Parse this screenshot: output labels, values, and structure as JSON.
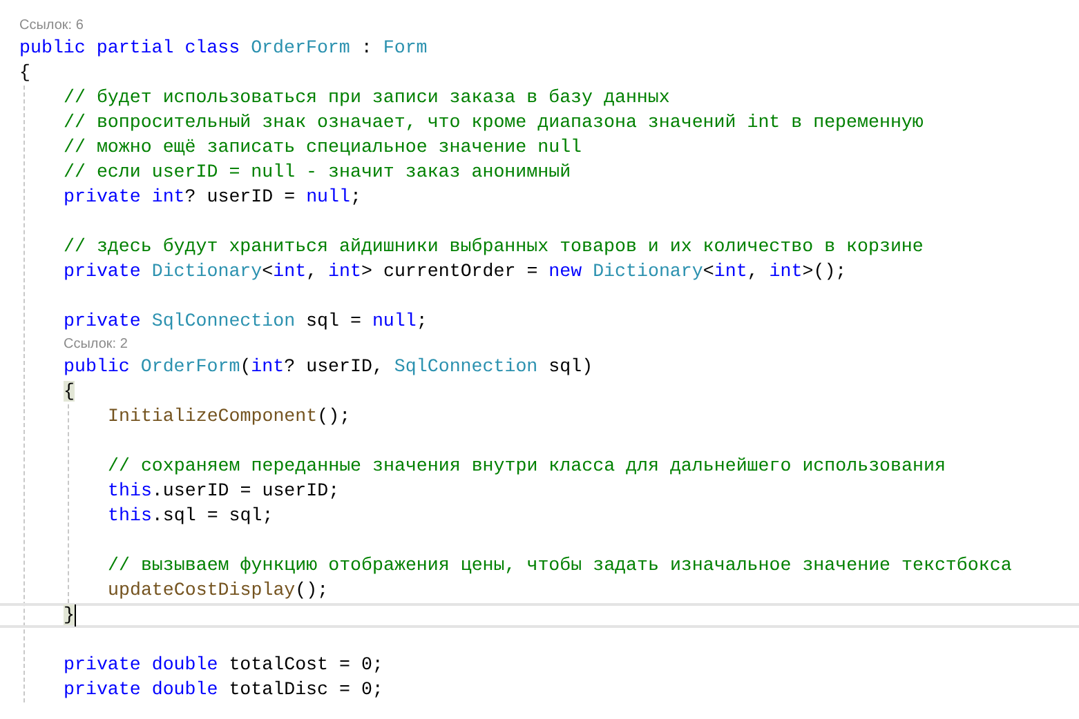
{
  "code": [
    {
      "kind": "lens",
      "text": "Ссылок: 6"
    },
    {
      "kind": "line",
      "tokens": [
        {
          "kind": "keyword",
          "text": "public partial class "
        },
        {
          "kind": "type",
          "text": "OrderForm"
        },
        {
          "kind": "plain",
          "text": " : "
        },
        {
          "kind": "type",
          "text": "Form"
        }
      ]
    },
    {
      "kind": "line",
      "tokens": [
        {
          "kind": "plain",
          "text": "{"
        }
      ]
    },
    {
      "kind": "block",
      "children": [
        {
          "kind": "line",
          "tokens": [
            {
              "kind": "comment",
              "text": "// будет использоваться при записи заказа в базу данных"
            }
          ]
        },
        {
          "kind": "line",
          "tokens": [
            {
              "kind": "comment",
              "text": "// вопросительный знак означает, что кроме диапазона значений int в переменную"
            }
          ]
        },
        {
          "kind": "line",
          "tokens": [
            {
              "kind": "comment",
              "text": "// можно ещё записать специальное значение null"
            }
          ]
        },
        {
          "kind": "line",
          "tokens": [
            {
              "kind": "comment",
              "text": "// если userID = null - значит заказ анонимный"
            }
          ]
        },
        {
          "kind": "line",
          "tokens": [
            {
              "kind": "keyword",
              "text": "private int"
            },
            {
              "kind": "plain",
              "text": "? userID = "
            },
            {
              "kind": "keyword",
              "text": "null"
            },
            {
              "kind": "plain",
              "text": ";"
            }
          ]
        },
        {
          "kind": "blank"
        },
        {
          "kind": "line",
          "tokens": [
            {
              "kind": "comment",
              "text": "// здесь будут храниться айдишники выбранных товаров и их количество в корзине"
            }
          ]
        },
        {
          "kind": "line",
          "tokens": [
            {
              "kind": "keyword",
              "text": "private "
            },
            {
              "kind": "type",
              "text": "Dictionary"
            },
            {
              "kind": "plain",
              "text": "<"
            },
            {
              "kind": "keyword",
              "text": "int"
            },
            {
              "kind": "plain",
              "text": ", "
            },
            {
              "kind": "keyword",
              "text": "int"
            },
            {
              "kind": "plain",
              "text": "> currentOrder = "
            },
            {
              "kind": "keyword",
              "text": "new "
            },
            {
              "kind": "type",
              "text": "Dictionary"
            },
            {
              "kind": "plain",
              "text": "<"
            },
            {
              "kind": "keyword",
              "text": "int"
            },
            {
              "kind": "plain",
              "text": ", "
            },
            {
              "kind": "keyword",
              "text": "int"
            },
            {
              "kind": "plain",
              "text": ">();"
            }
          ]
        },
        {
          "kind": "blank"
        },
        {
          "kind": "line",
          "tokens": [
            {
              "kind": "keyword",
              "text": "private "
            },
            {
              "kind": "type",
              "text": "SqlConnection"
            },
            {
              "kind": "plain",
              "text": " sql = "
            },
            {
              "kind": "keyword",
              "text": "null"
            },
            {
              "kind": "plain",
              "text": ";"
            }
          ]
        },
        {
          "kind": "lens",
          "text": "Ссылок: 2"
        },
        {
          "kind": "line",
          "tokens": [
            {
              "kind": "keyword",
              "text": "public "
            },
            {
              "kind": "type",
              "text": "OrderForm"
            },
            {
              "kind": "plain",
              "text": "("
            },
            {
              "kind": "keyword",
              "text": "int"
            },
            {
              "kind": "plain",
              "text": "? userID, "
            },
            {
              "kind": "type",
              "text": "SqlConnection"
            },
            {
              "kind": "plain",
              "text": " sql)"
            }
          ]
        },
        {
          "kind": "line",
          "tokens": [
            {
              "kind": "brace_match",
              "text": "{"
            }
          ]
        },
        {
          "kind": "block",
          "children": [
            {
              "kind": "line",
              "tokens": [
                {
                  "kind": "method",
                  "text": "InitializeComponent"
                },
                {
                  "kind": "plain",
                  "text": "();"
                }
              ]
            },
            {
              "kind": "blank"
            },
            {
              "kind": "line",
              "tokens": [
                {
                  "kind": "comment",
                  "text": "// сохраняем переданные значения внутри класса для дальнейшего использования"
                }
              ]
            },
            {
              "kind": "line",
              "tokens": [
                {
                  "kind": "keyword",
                  "text": "this"
                },
                {
                  "kind": "plain",
                  "text": ".userID = userID;"
                }
              ]
            },
            {
              "kind": "line",
              "tokens": [
                {
                  "kind": "keyword",
                  "text": "this"
                },
                {
                  "kind": "plain",
                  "text": ".sql = sql;"
                }
              ]
            },
            {
              "kind": "blank"
            },
            {
              "kind": "line",
              "tokens": [
                {
                  "kind": "comment",
                  "text": "// вызываем функцию отображения цены, чтобы задать изначальное значение текстбокса"
                }
              ]
            },
            {
              "kind": "line",
              "tokens": [
                {
                  "kind": "method",
                  "text": "updateCostDisplay"
                },
                {
                  "kind": "plain",
                  "text": "();"
                }
              ]
            }
          ]
        },
        {
          "kind": "current_line",
          "tokens": [
            {
              "kind": "brace_match",
              "text": "}"
            }
          ]
        },
        {
          "kind": "blank"
        },
        {
          "kind": "line",
          "tokens": [
            {
              "kind": "keyword",
              "text": "private double "
            },
            {
              "kind": "plain",
              "text": "totalCost = 0;"
            }
          ]
        },
        {
          "kind": "line",
          "tokens": [
            {
              "kind": "keyword",
              "text": "private double "
            },
            {
              "kind": "plain",
              "text": "totalDisc = 0;"
            }
          ]
        }
      ]
    }
  ]
}
